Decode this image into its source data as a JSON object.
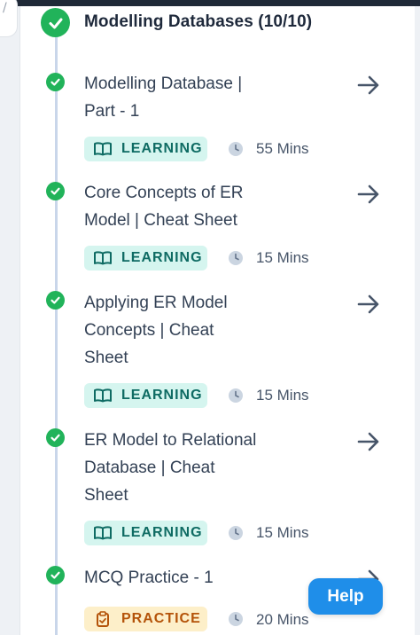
{
  "section": {
    "title": "Modelling Databases (10/10)"
  },
  "items": [
    {
      "title_lines": [
        "Modelling Database |",
        "Part - 1"
      ],
      "badge": "LEARNING",
      "badge_icon": "book-icon",
      "duration": "55 Mins"
    },
    {
      "title_lines": [
        "Core Concepts of ER",
        "Model | Cheat Sheet"
      ],
      "badge": "LEARNING",
      "badge_icon": "book-icon",
      "duration": "15 Mins"
    },
    {
      "title_lines": [
        "Applying ER Model",
        "Concepts | Cheat",
        "Sheet"
      ],
      "badge": "LEARNING",
      "badge_icon": "book-icon",
      "duration": "15 Mins"
    },
    {
      "title_lines": [
        "ER Model to Relational",
        "Database | Cheat",
        "Sheet"
      ],
      "badge": "LEARNING",
      "badge_icon": "book-icon",
      "duration": "15 Mins"
    },
    {
      "title_lines": [
        "MCQ Practice - 1"
      ],
      "badge": "PRACTICE",
      "badge_icon": "clipboard-icon",
      "duration": "20 Mins"
    }
  ],
  "help_button": {
    "label": "Help"
  },
  "colors": {
    "check_green": "#21b35a",
    "learning_bg": "#d5f5ef",
    "learning_text": "#0e6b63",
    "practice_bg": "#fdefc9",
    "practice_text": "#b45309",
    "help_blue": "#1f8ee9",
    "timeline": "#c9d6ea"
  }
}
